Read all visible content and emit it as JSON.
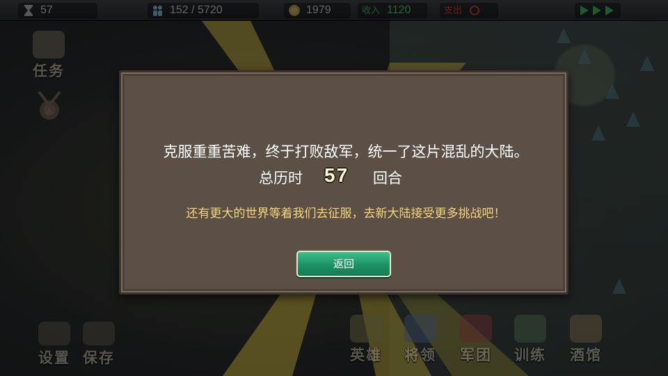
{
  "topbar": {
    "turn": "57",
    "population": "152 / 5720",
    "gold": "1979",
    "income_label": "收入",
    "income_value": "1120",
    "expense_label": "支出"
  },
  "side_menu": {
    "quest_label": "任务"
  },
  "bottom_left": {
    "settings_label": "设置",
    "save_label": "保存"
  },
  "bottom_right": {
    "hero_label": "英雄",
    "general_label": "将领",
    "legion_label": "军团",
    "train_label": "训练",
    "tavern_label": "酒馆"
  },
  "dialog": {
    "message": "克服重重苦难，终于打败敌军，统一了这片混乱的大陆。",
    "elapsed_prefix": "总历时",
    "turns": "57",
    "elapsed_suffix": "回合",
    "hint": "还有更大的世界等着我们去征服，去新大陆接受更多挑战吧！",
    "return_label": "返回"
  },
  "colors": {
    "dialog_bg": "#5c5046",
    "hint_text": "#f2d57a",
    "button_green": "#1d9265",
    "income_green": "#3fbf6a",
    "expense_red": "#d23a3a"
  }
}
